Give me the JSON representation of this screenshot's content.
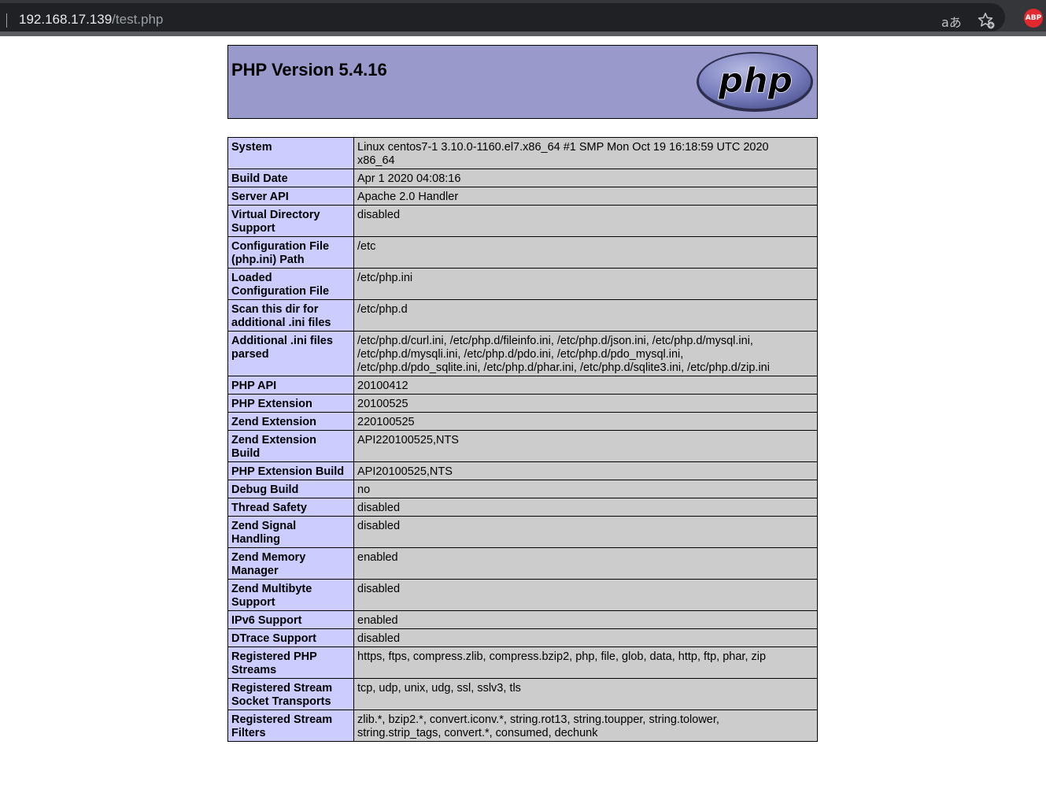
{
  "browser": {
    "url_host": "192.168.17.139",
    "url_path": "/test.php",
    "translate_glyph": "aあ",
    "extension_label": "ABP"
  },
  "header": {
    "title": "PHP Version 5.4.16",
    "logo_text": "php"
  },
  "rows": [
    {
      "key": "System",
      "value": "Linux centos7-1 3.10.0-1160.el7.x86_64 #1 SMP Mon Oct 19 16:18:59 UTC 2020\nx86_64"
    },
    {
      "key": "Build Date",
      "value": "Apr 1 2020 04:08:16"
    },
    {
      "key": "Server API",
      "value": "Apache 2.0 Handler"
    },
    {
      "key": "Virtual Directory\nSupport",
      "value": "disabled"
    },
    {
      "key": "Configuration File\n(php.ini) Path",
      "value": "/etc"
    },
    {
      "key": "Loaded\nConfiguration File",
      "value": "/etc/php.ini"
    },
    {
      "key": "Scan this dir for\nadditional .ini files",
      "value": "/etc/php.d"
    },
    {
      "key": "Additional .ini files\nparsed",
      "value": "/etc/php.d/curl.ini, /etc/php.d/fileinfo.ini, /etc/php.d/json.ini, /etc/php.d/mysql.ini,\n/etc/php.d/mysqli.ini, /etc/php.d/pdo.ini, /etc/php.d/pdo_mysql.ini,\n/etc/php.d/pdo_sqlite.ini, /etc/php.d/phar.ini, /etc/php.d/sqlite3.ini, /etc/php.d/zip.ini"
    },
    {
      "key": "PHP API",
      "value": "20100412"
    },
    {
      "key": "PHP Extension",
      "value": "20100525"
    },
    {
      "key": "Zend Extension",
      "value": "220100525"
    },
    {
      "key": "Zend Extension\nBuild",
      "value": "API220100525,NTS"
    },
    {
      "key": "PHP Extension Build",
      "value": "API20100525,NTS"
    },
    {
      "key": "Debug Build",
      "value": "no"
    },
    {
      "key": "Thread Safety",
      "value": "disabled"
    },
    {
      "key": "Zend Signal\nHandling",
      "value": "disabled"
    },
    {
      "key": "Zend Memory\nManager",
      "value": "enabled"
    },
    {
      "key": "Zend Multibyte\nSupport",
      "value": "disabled"
    },
    {
      "key": "IPv6 Support",
      "value": "enabled"
    },
    {
      "key": "DTrace Support",
      "value": "disabled"
    },
    {
      "key": "Registered PHP\nStreams",
      "value": "https, ftps, compress.zlib, compress.bzip2, php, file, glob, data, http, ftp, phar, zip"
    },
    {
      "key": "Registered Stream\nSocket Transports",
      "value": "tcp, udp, unix, udg, ssl, sslv3, tls"
    },
    {
      "key": "Registered Stream\nFilters",
      "value": "zlib.*, bzip2.*, convert.iconv.*, string.rot13, string.toupper, string.tolower,\nstring.strip_tags, convert.*, consumed, dechunk"
    }
  ]
}
